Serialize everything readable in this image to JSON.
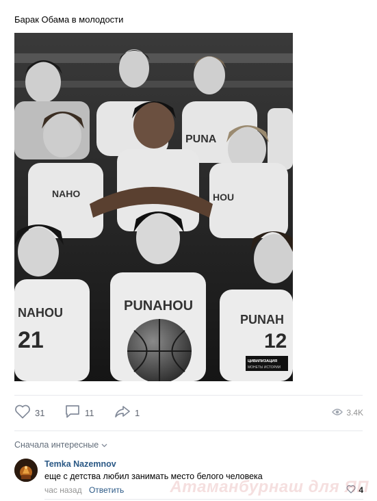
{
  "post": {
    "text": "Барак Обама в молодости",
    "photo_jersey_text": "PUNAHOU",
    "photo_numbers": [
      "21",
      "12"
    ],
    "photo_stamp_line1": "ЦИВИЛИЗАЦИЯ",
    "photo_stamp_line2": "МОНЕТЫ ИСТОРИИ"
  },
  "actions": {
    "likes": "31",
    "comments": "11",
    "shares": "1",
    "views": "3.4K"
  },
  "comments_sort": {
    "label": "Сначала интересные"
  },
  "comment": {
    "author": "Temka Nazemnov",
    "text": "еще с детства любил занимать место белого человека",
    "time": "час назад",
    "reply_label": "Ответить",
    "likes": "4"
  },
  "watermark": "Атаманбурнаш для ЯП",
  "colors": {
    "link": "#2a5885",
    "icon": "#828a99",
    "meta": "#939393",
    "divider": "#e7e8ec"
  },
  "icons": [
    "heart-icon",
    "comment-icon",
    "share-icon",
    "eye-icon",
    "chevron-down-icon"
  ]
}
